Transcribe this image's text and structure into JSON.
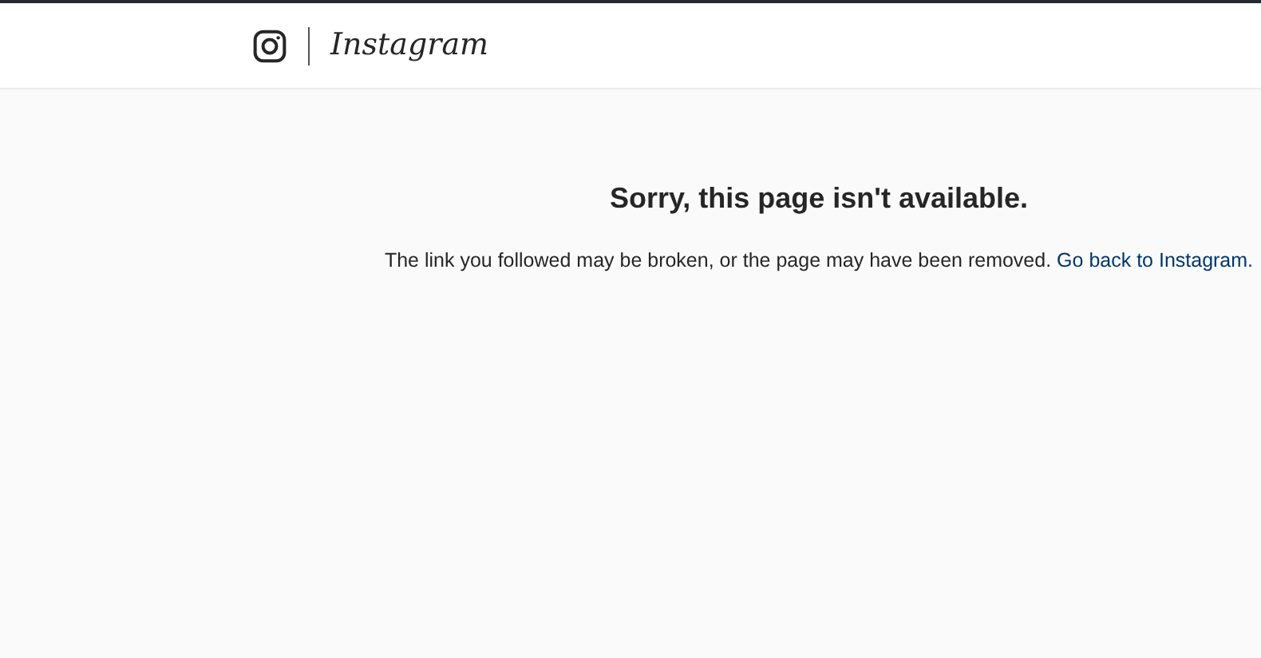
{
  "header": {
    "wordmark": "Instagram"
  },
  "error": {
    "title": "Sorry, this page isn't available.",
    "message": "The link you followed may be broken, or the page may have been removed.",
    "link": "Go back to Instagram."
  }
}
